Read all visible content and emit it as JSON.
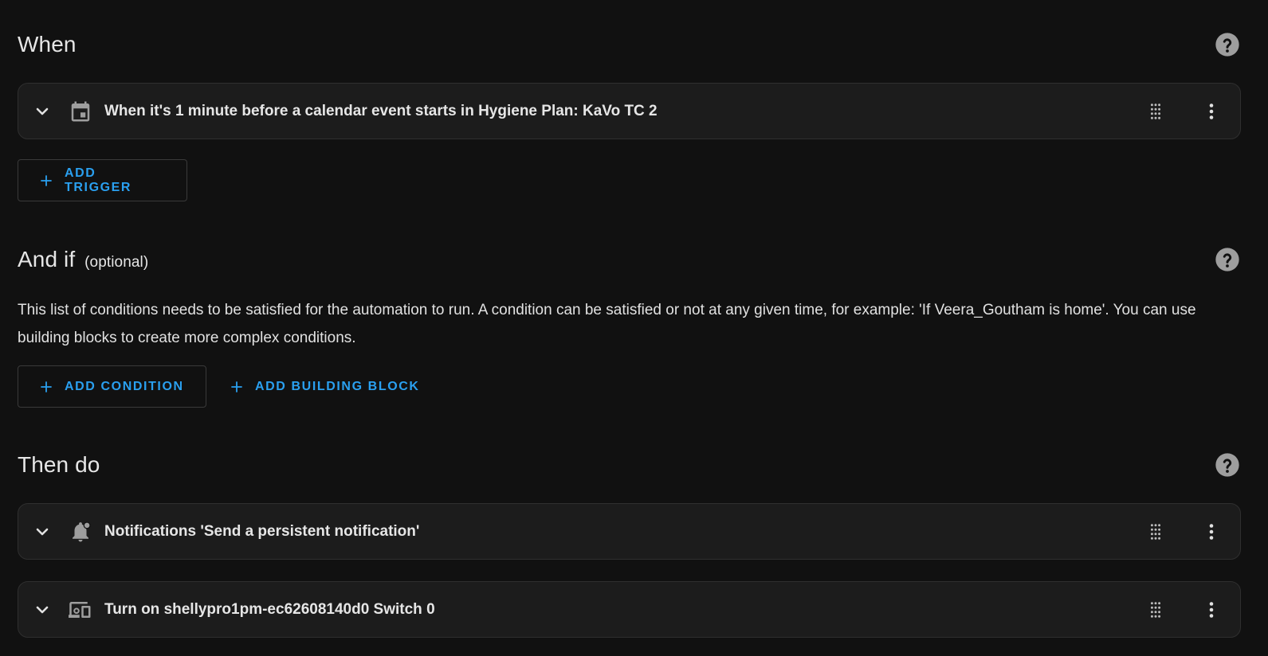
{
  "when": {
    "title": "When",
    "triggers": [
      {
        "label": "When it's 1 minute before a calendar event starts in Hygiene Plan: KaVo TC 2",
        "icon": "calendar-icon"
      }
    ],
    "add_trigger_label": "ADD TRIGGER"
  },
  "and_if": {
    "title": "And if",
    "optional": "(optional)",
    "description": "This list of conditions needs to be satisfied for the automation to run. A condition can be satisfied or not at any given time, for example: 'If Veera_Goutham is home'. You can use building blocks to create more complex conditions.",
    "add_condition_label": "ADD CONDITION",
    "add_building_block_label": "ADD BUILDING BLOCK"
  },
  "then_do": {
    "title": "Then do",
    "actions": [
      {
        "label": "Notifications 'Send a persistent notification'",
        "icon": "bell-badge-icon"
      },
      {
        "label": "Turn on shellypro1pm-ec62608140d0 Switch 0",
        "icon": "devices-icon"
      }
    ]
  },
  "colors": {
    "background": "#111111",
    "card": "#1c1c1c",
    "accent": "#2aa0f0",
    "icon": "#9e9e9e"
  }
}
